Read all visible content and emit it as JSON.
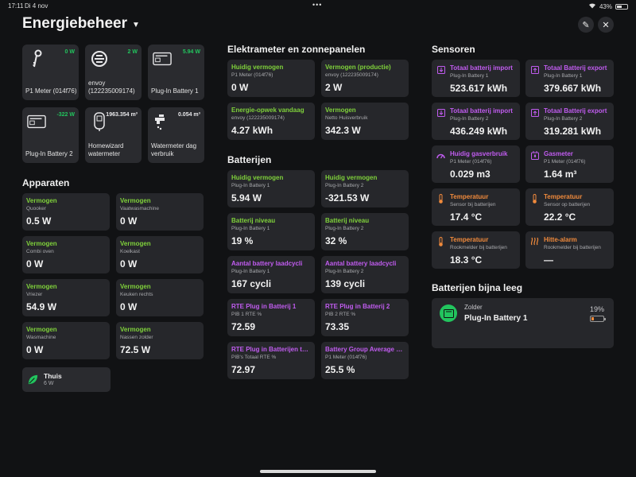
{
  "status": {
    "time": "17:11",
    "date": "Di 4 nov",
    "battery": "43%"
  },
  "header": {
    "title": "Energiebeheer"
  },
  "tiles": [
    {
      "name": "P1 Meter (014f76)",
      "value": "0 W",
      "color": "#22c55e",
      "icon": "p1-meter-icon"
    },
    {
      "name": "envoy (122235009174)",
      "value": "2 W",
      "color": "#22c55e",
      "icon": "envoy-icon"
    },
    {
      "name": "Plug-In Battery 1",
      "value": "5.94 W",
      "color": "#22c55e",
      "icon": "battery-icon"
    },
    {
      "name": "Plug-In Battery 2",
      "value": "-322 W",
      "color": "#22c55e",
      "icon": "battery-icon"
    },
    {
      "name": "Homewizard watermeter",
      "value": "1963.354 m³",
      "color": "#e8e8ea",
      "icon": "watermeter-icon"
    },
    {
      "name": "Watermeter dag verbruik",
      "value": "0.054 m³",
      "color": "#e8e8ea",
      "icon": "faucet-icon"
    }
  ],
  "apparaten": {
    "title": "Apparaten",
    "items": [
      {
        "label": "Vermogen",
        "sub": "Quooker",
        "value": "0.5 W"
      },
      {
        "label": "Vermogen",
        "sub": "Vaatwasmachine",
        "value": "0 W"
      },
      {
        "label": "Vermogen",
        "sub": "Combi oven",
        "value": "0 W"
      },
      {
        "label": "Vermogen",
        "sub": "Koelkast",
        "value": "0 W"
      },
      {
        "label": "Vermogen",
        "sub": "Vriezer",
        "value": "54.9 W"
      },
      {
        "label": "Vermogen",
        "sub": "Keuken rechts",
        "value": "0 W"
      },
      {
        "label": "Vermogen",
        "sub": "Wasmachine",
        "value": "0 W"
      },
      {
        "label": "Vermogen",
        "sub": "Nassen zolder",
        "value": "72.5 W"
      }
    ],
    "thuis": {
      "name": "Thuis",
      "value": "6 W"
    }
  },
  "elektra": {
    "title": "Elektrameter en zonnepanelen",
    "items": [
      {
        "label": "Huidig vermogen",
        "sub": "P1 Meter (014f76)",
        "value": "0 W"
      },
      {
        "label": "Vermogen (productie)",
        "sub": "envoy (122235009174)",
        "value": "2 W"
      },
      {
        "label": "Energie-opwek vandaag",
        "sub": "envoy (122235009174)",
        "value": "4.27 kWh"
      },
      {
        "label": "Vermogen",
        "sub": "Netto Huisverbruik",
        "value": "342.3 W"
      }
    ]
  },
  "batterijen": {
    "title": "Batterijen",
    "items": [
      {
        "label": "Huidig vermogen",
        "sub": "Plug-In Battery 1",
        "value": "5.94 W",
        "color": "green"
      },
      {
        "label": "Huidig vermogen",
        "sub": "Plug-In Battery 2",
        "value": "-321.53 W",
        "color": "green"
      },
      {
        "label": "Batterij niveau",
        "sub": "Plug-In Battery 1",
        "value": "19 %",
        "color": "green"
      },
      {
        "label": "Batterij niveau",
        "sub": "Plug-In Battery 2",
        "value": "32 %",
        "color": "green"
      },
      {
        "label": "Aantal battery laadcycli",
        "sub": "Plug-In Battery 1",
        "value": "167 cycli",
        "color": "purple"
      },
      {
        "label": "Aantal battery laadcycli",
        "sub": "Plug-In Battery 2",
        "value": "139 cycli",
        "color": "purple"
      },
      {
        "label": "RTE Plug in Batterij 1",
        "sub": "PIB 1 RTE %",
        "value": "72.59",
        "color": "purple"
      },
      {
        "label": "RTE Plug in Batterij 2",
        "sub": "PIB 2 RTE %",
        "value": "73.35",
        "color": "purple"
      },
      {
        "label": "RTE Plug in Batterijen tot...",
        "sub": "PIB's Totaal RTE %",
        "value": "72.97",
        "color": "purple"
      },
      {
        "label": "Battery Group Average SoC",
        "sub": "P1 Meter (014f76)",
        "value": "25.5 %",
        "color": "purple"
      }
    ]
  },
  "sensoren": {
    "title": "Sensoren",
    "items": [
      {
        "label": "Totaal batterij import",
        "sub": "Plug-In Battery 1",
        "value": "523.617 kWh",
        "color": "purple",
        "icon": "meter-import-icon"
      },
      {
        "label": "Totaal Batterij export",
        "sub": "Plug-In Battery 1",
        "value": "379.667 kWh",
        "color": "purple",
        "icon": "meter-export-icon"
      },
      {
        "label": "Totaal batterij import",
        "sub": "Plug-In Battery 2",
        "value": "436.249 kWh",
        "color": "purple",
        "icon": "meter-import-icon"
      },
      {
        "label": "Totaal Batterij export",
        "sub": "Plug-In Battery 2",
        "value": "319.281 kWh",
        "color": "purple",
        "icon": "meter-export-icon"
      },
      {
        "label": "Huidig gasverbruik",
        "sub": "P1 Meter (014f76)",
        "value": "0.029 m3",
        "color": "purple",
        "icon": "gauge-icon"
      },
      {
        "label": "Gasmeter",
        "sub": "P1 Meter (014f76)",
        "value": "1.64 m³",
        "color": "purple",
        "icon": "gas-meter-icon"
      },
      {
        "label": "Temperatuur",
        "sub": "Sensor bij batterijen",
        "value": "17.4 °C",
        "color": "orange",
        "icon": "thermometer-icon"
      },
      {
        "label": "Temperatuur",
        "sub": "Sensor op batterijen",
        "value": "22.2 °C",
        "color": "orange",
        "icon": "thermometer-icon"
      },
      {
        "label": "Temperatuur",
        "sub": "Rookmelder bij batterijen",
        "value": "18.3 °C",
        "color": "orange",
        "icon": "thermometer-icon"
      },
      {
        "label": "Hitte-alarm",
        "sub": "Rookmelder bij batterijen",
        "value": "—",
        "color": "orange",
        "icon": "heat-icon"
      }
    ]
  },
  "low_battery": {
    "title": "Batterijen bijna leeg",
    "area": "Zolder",
    "device": "Plug-In Battery 1",
    "percent": "19%",
    "level": 0.19
  }
}
